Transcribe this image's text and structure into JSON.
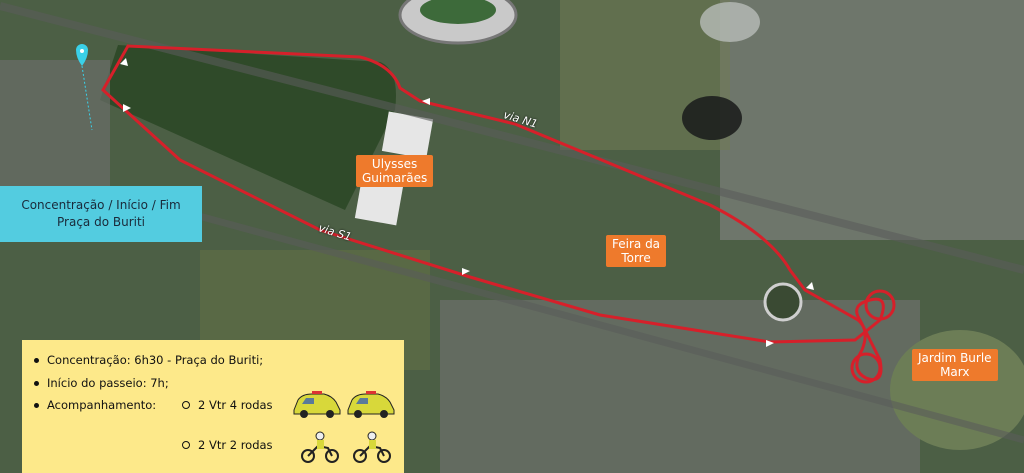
{
  "roads": {
    "n1": "via N1",
    "s1": "via S1"
  },
  "places": {
    "ulysses": "Ulysses\nGuimarães",
    "feira": "Feira da\nTorre",
    "jardim": "Jardim Burle\nMarx"
  },
  "start_box": {
    "line1": "Concentração / Início / Fim",
    "line2": "Praça do Buriti"
  },
  "legend": {
    "item1": "Concentração: 6h30 - Praça do Buriti;",
    "item2": "Início do passeio: 7h;",
    "item3": "Acompanhamento:",
    "sub1": "2 Vtr 4 rodas",
    "sub2": "2 Vtr 2 rodas"
  },
  "colors": {
    "route": "#d6202a",
    "label_bg": "#ee7a2c",
    "start_box_bg": "#53cce0",
    "legend_bg": "#fde98a",
    "pin": "#3ad0e8"
  },
  "icons": {
    "pin": "location-pin-icon",
    "car": "police-car-icon",
    "moto": "police-motorcycle-icon"
  }
}
